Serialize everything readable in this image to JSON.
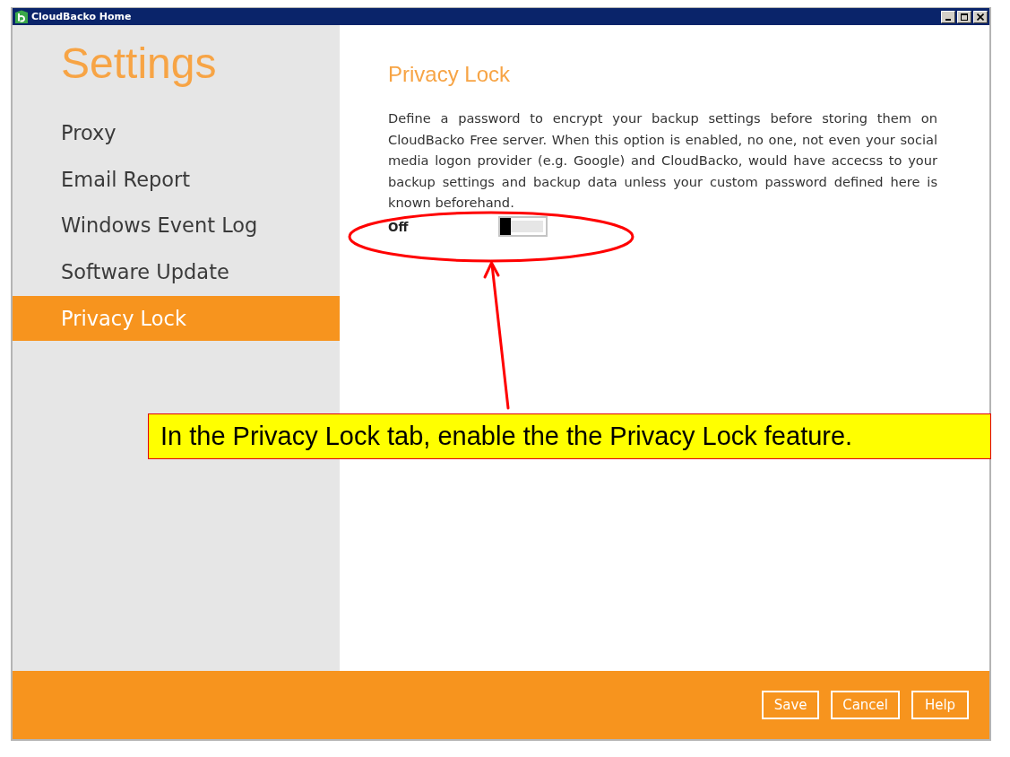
{
  "window": {
    "title": "CloudBacko Home"
  },
  "sidebar": {
    "title": "Settings",
    "items": [
      {
        "label": "Proxy",
        "selected": false
      },
      {
        "label": "Email Report",
        "selected": false
      },
      {
        "label": "Windows Event Log",
        "selected": false
      },
      {
        "label": "Software Update",
        "selected": false
      },
      {
        "label": "Privacy Lock",
        "selected": true
      }
    ]
  },
  "panel": {
    "heading": "Privacy Lock",
    "description": "Define a password to encrypt your backup settings before storing them on CloudBacko Free server. When this option is enabled, no one, not even your social media logon provider (e.g. Google) and CloudBacko, would have accecss to your backup settings and backup data unless your custom password defined here is known beforehand.",
    "toggle": {
      "label": "Off",
      "on": false
    }
  },
  "footer": {
    "buttons": [
      "Save",
      "Cancel",
      "Help"
    ]
  },
  "annotation": {
    "callout": "In the Privacy Lock tab, enable the the Privacy Lock feature."
  }
}
